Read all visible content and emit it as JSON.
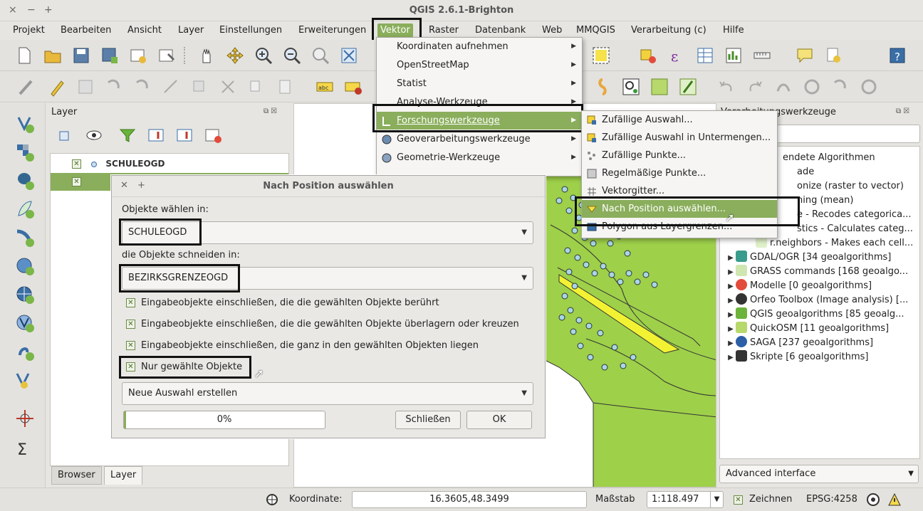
{
  "window": {
    "title": "QGIS 2.6.1-Brighton",
    "controls": [
      "×",
      "−",
      "+"
    ]
  },
  "menubar": {
    "items": [
      "Projekt",
      "Bearbeiten",
      "Ansicht",
      "Layer",
      "Einstellungen",
      "Erweiterungen",
      "Vektor",
      "Raster",
      "Datenbank",
      "Web",
      "MMQGIS",
      "Verarbeitung (c)",
      "Hilfe"
    ]
  },
  "vector_menu": {
    "items": [
      "Koordinaten aufnehmen",
      "OpenStreetMap",
      "Statist",
      "Analyse-Werkzeuge",
      "Forschungswerkzeuge",
      "Geoverarbeitungswerkzeuge",
      "Geometrie-Werkzeuge"
    ]
  },
  "research_menu": {
    "items": [
      "Zufällige Auswahl...",
      "Zufällige Auswahl in Untermengen...",
      "Zufällige Punkte...",
      "Regelmäßige Punkte...",
      "Vektorgitter...",
      "Nach Position auswählen...",
      "Polygon aus Layergrenzen..."
    ]
  },
  "layer_panel": {
    "title": "Layer",
    "layers": [
      "SCHULEOGD"
    ],
    "tabs": [
      "Browser",
      "Layer"
    ]
  },
  "processing_panel": {
    "title": "Verarbeitungswerkzeuge",
    "rows_top": [
      "endete Algorithmen",
      "ade",
      "onize (raster to vector)",
      "ning (mean)",
      "e - Recodes categorica...",
      "stics - Calculates categ...",
      "r.neighbors - Makes each cell..."
    ],
    "providers": [
      "GDAL/OGR [34 geoalgorithms]",
      "GRASS commands [168 geoalgo...",
      "Modelle [0 geoalgorithms]",
      "Orfeo Toolbox (Image analysis) [...",
      "QGIS geoalgorithms [85 geoalg...",
      "QuickOSM [11 geoalgorithms]",
      "SAGA [237 geoalgorithms]",
      "Skripte [6 geoalgorithms]"
    ],
    "advanced": "Advanced interface"
  },
  "dialog": {
    "title": "Nach Position auswählen",
    "label_select_in": "Objekte wählen in:",
    "select_in_value": "SCHULEOGD",
    "label_intersect": "die Objekte schneiden in:",
    "intersect_value": "BEZIRKSGRENZEOGD",
    "options": [
      "Eingabeobjekte einschließen, die die gewählten Objekte berührt",
      "Eingabeobjekte einschließen, die die gewählten Objekte überlagern oder kreuzen",
      "Eingabeobjekte einschließen, die ganz in den gewählten Objekten liegen",
      "Nur gewählte Objekte"
    ],
    "mode": "Neue Auswahl erstellen",
    "progress": "0%",
    "progress_value": 0,
    "close_btn": "Schließen",
    "ok_btn": "OK"
  },
  "statusbar": {
    "coord_label": "Koordinate:",
    "coord_value": "16.3605,48.3499",
    "scale_label": "Maßstab",
    "scale_value": "1:118.497",
    "render_label": "Zeichnen",
    "crs": "EPSG:4258"
  }
}
